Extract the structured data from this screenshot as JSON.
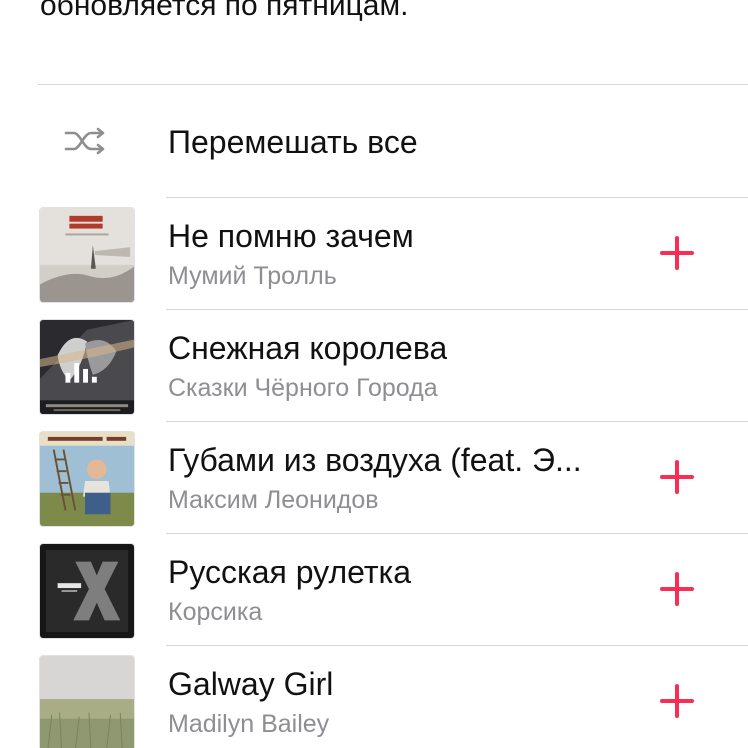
{
  "header": {
    "description": "обновляется по пятницам."
  },
  "shuffle": {
    "label": "Перемешать все",
    "icon": "shuffle-icon"
  },
  "accent_color": "#fa2d55",
  "tracks": [
    {
      "title": "Не помню зачем",
      "artist": "Мумий Тролль",
      "artwork_label": "МУМИЙ ТРОЛЛЬ",
      "has_add_button": true
    },
    {
      "title": "Снежная королева",
      "artist": "Сказки Чёрного Города",
      "artwork_label": "Сказки Чёрного Города",
      "has_add_button": false,
      "now_playing": true
    },
    {
      "title": "Губами из воздуха (feat. Э...",
      "artist": "Максим Леонидов",
      "artwork_label": "Максим Леонидов · Ход",
      "has_add_button": true
    },
    {
      "title": "Русская рулетка",
      "artist": "Корсика",
      "artwork_label": "КОРСИКА",
      "has_add_button": true
    },
    {
      "title": "Galway Girl",
      "artist": "Madilyn Bailey",
      "has_add_button": true
    }
  ]
}
